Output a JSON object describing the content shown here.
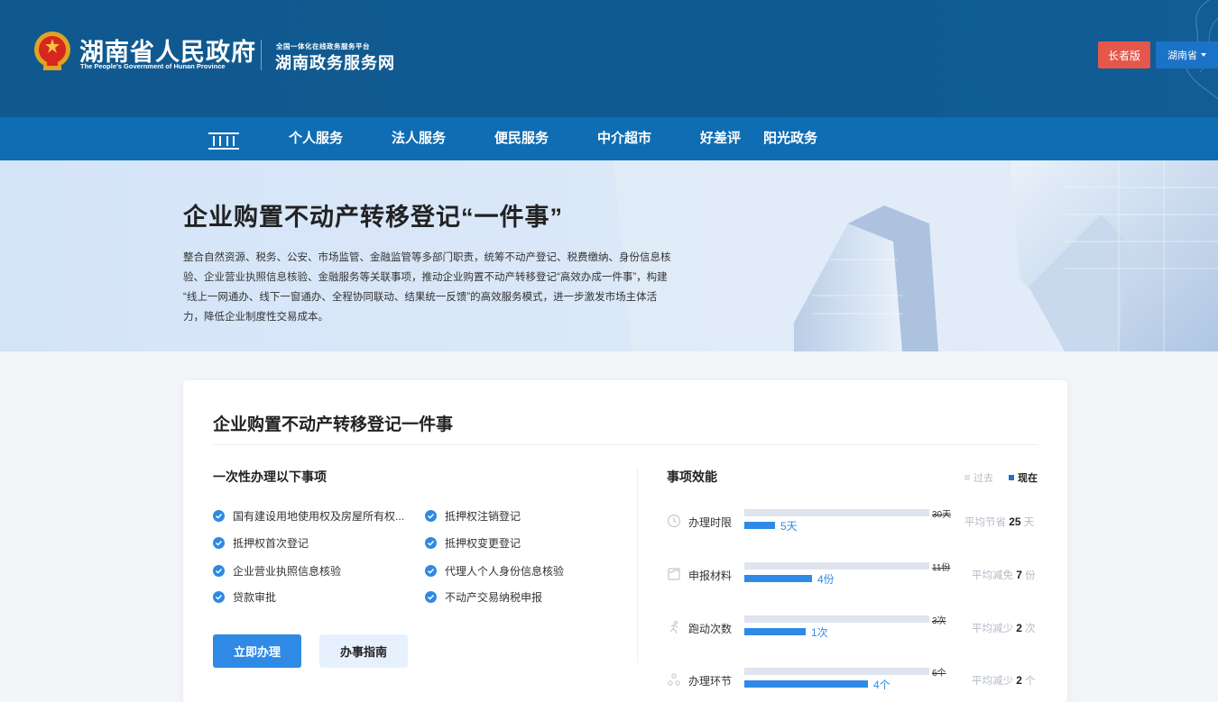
{
  "header": {
    "gov_title": "湖南省人民政府",
    "gov_subtitle": "The People's Government of Hunan Province",
    "platform_small": "全国一体化在线政务服务平台",
    "platform_title": "湖南政务服务网",
    "elder_mode_label": "长者版",
    "region_label": "湖南省"
  },
  "nav": {
    "items": [
      "个人服务",
      "法人服务",
      "便民服务",
      "中介超市",
      "好差评",
      "阳光政务"
    ]
  },
  "banner": {
    "title": "企业购置不动产转移登记“一件事”",
    "desc_lines": [
      "整合自然资源、税务、公安、市场监管、金融监管等多部门职责，统筹不动产登记、税费缴纳、身份信息核",
      "验、企业营业执照信息核验、金融服务等关联事项，推动企业购置不动产转移登记“高效办成一件事”，构建",
      "“线上一网通办、线下一窗通办、全程协同联动、结果统一反馈”的高效服务模式，进一步激发市场主体活",
      "力，降低企业制度性交易成本。"
    ]
  },
  "card": {
    "title": "企业购置不动产转移登记一件事",
    "items_title": "一次性办理以下事项",
    "items": [
      "国有建设用地使用权及房屋所有权...",
      "抵押权注销登记",
      "抵押权首次登记",
      "抵押权变更登记",
      "企业营业执照信息核验",
      "代理人个人身份信息核验",
      "贷款审批",
      "不动产交易纳税申报"
    ],
    "apply_label": "立即办理",
    "guide_label": "办事指南",
    "efficiency_title": "事项效能",
    "legend_past": "过去",
    "legend_now": "现在",
    "metrics": [
      {
        "label": "办理时限",
        "past_value": 30,
        "past_text": "30天",
        "now_value": 5,
        "now_text": "5天",
        "saving_prefix": "平均节省",
        "saving_value": "25",
        "saving_unit": "天"
      },
      {
        "label": "申报材料",
        "past_value": 11,
        "past_text": "11份",
        "now_value": 4,
        "now_text": "4份",
        "saving_prefix": "平均减免",
        "saving_value": "7",
        "saving_unit": "份"
      },
      {
        "label": "跑动次数",
        "past_value": 3,
        "past_text": "3次",
        "now_value": 1,
        "now_text": "1次",
        "saving_prefix": "平均减少",
        "saving_value": "2",
        "saving_unit": "次"
      },
      {
        "label": "办理环节",
        "past_value": 6,
        "past_text": "6个",
        "now_value": 4,
        "now_text": "4个",
        "saving_prefix": "平均减少",
        "saving_value": "2",
        "saving_unit": "个"
      }
    ]
  },
  "colors": {
    "header_bg": "#10598f",
    "nav_bg": "#0f6db3",
    "primary": "#2f8ae6",
    "elder_btn": "#e4574a",
    "past_bar": "#dfe4ee"
  }
}
